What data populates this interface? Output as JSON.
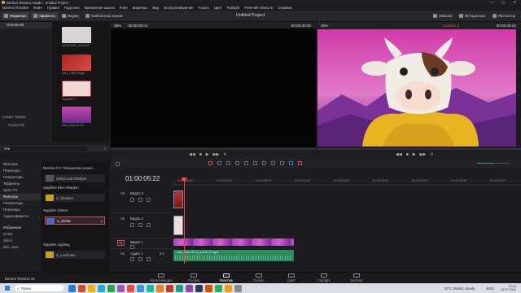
{
  "window": {
    "title": "DaVinci Resolve Studio - Untitled Project",
    "controls": [
      "—",
      "▢",
      "✕"
    ]
  },
  "menu": [
    "DaVinci Resolve",
    "Файл",
    "Правка",
    "Подгонка",
    "Временная шкала",
    "Клип",
    "Маркеры",
    "Вид",
    "Воспроизведение",
    "Fusion",
    "Цвет",
    "Fairlight",
    "Рабочий области",
    "Справка"
  ],
  "toolbar": {
    "left": [
      {
        "label": "Медиапул",
        "icon": "media-pool-icon",
        "active": true
      },
      {
        "label": "Эффекты",
        "icon": "effects-icon",
        "active": true
      },
      {
        "label": "Индекс",
        "icon": "index-icon",
        "active": false
      },
      {
        "label": "Библиотека звуков",
        "icon": "sound-library-icon",
        "active": false
      }
    ],
    "project_title": "Untitled Project",
    "right": [
      {
        "label": "Микшер",
        "icon": "mixer-icon"
      },
      {
        "label": "Метаданные",
        "icon": "metadata-icon"
      },
      {
        "label": "Инспектор",
        "icon": "inspector-icon"
      }
    ]
  },
  "viewer_bar": {
    "source_zoom": "39%",
    "source_tc": "00:00:00:01",
    "source_tc_right": "00:00:00:00",
    "program_zoom": "39%",
    "program_tc": "00:00:05:22",
    "timeline_name": "Timeline 1"
  },
  "media_pool": {
    "bin_header": "Основной",
    "smart_bins_label": "Смарт-ящики",
    "keywords_label": "Keywords",
    "clips": [
      {
        "name": "12.09.2023_15.34.57",
        "color": "#d8d4d2"
      },
      {
        "name": "icon_1280.15.jpg",
        "color": "#b8322e"
      },
      {
        "name": "Tosprite 2",
        "color": "#e8c8c2"
      },
      {
        "name": "cow_2024-07-12...",
        "color": "#9a3fa0"
      }
    ]
  },
  "effects": {
    "search_value": "sha",
    "tree": [
      {
        "label": "Фильтры",
        "sel": false
      },
      {
        "label": "Переходы",
        "sel": false
      },
      {
        "label": "Генераторы",
        "sel": false
      },
      {
        "label": "Эффекты",
        "sel": false
      },
      {
        "label": "Open FX",
        "sel": false
      },
      {
        "label": "Фильтры",
        "sel": true
      },
      {
        "label": "Генераторы",
        "sel": false
      },
      {
        "label": "Переходы",
        "sel": false
      },
      {
        "label": "Аудиоэффекты",
        "sel": false
      }
    ],
    "favorites_label": "Избранное",
    "favorites": [
      "Cross",
      "Glitch",
      "Dirt...ssor"
    ],
    "groups": [
      {
        "header": "Resolve FX: Повышение резкос...",
        "items": [
          "Soften and Sharpen"
        ]
      },
      {
        "header": "Sapphire Blur+Sharpen",
        "items": [
          "S_Sharpen"
        ]
      },
      {
        "header": "Sapphire Distort",
        "items": [
          "S_Shake"
        ]
      },
      {
        "header": "Sapphire Lighting",
        "items": [
          "S_LensFlare"
        ]
      }
    ]
  },
  "timeline": {
    "timecode": "01:00:05:22",
    "ruler": [
      "01:00:00:00",
      "01:00:04:00",
      "01:00:08:00",
      "01:00:12:00",
      "01:00:16:00",
      "01:00:20:00",
      "01:00:24:00",
      "01:00:28:00",
      "01:00:32:00"
    ],
    "tracks": [
      {
        "id": "V3",
        "name": "Видео 3"
      },
      {
        "id": "V2",
        "name": "Видео 2"
      },
      {
        "id": "V1",
        "name": "Видео 1"
      },
      {
        "id": "A1",
        "name": "Аудио 1",
        "level": "2.0"
      }
    ],
    "audio_clip_name": "cow_2024-07-13_14-31-17.mp4",
    "v2_clip": "icon",
    "v3_clip": "icon"
  },
  "pages": [
    {
      "label": "Мультимедиа",
      "active": false
    },
    {
      "label": "Сборка",
      "active": false
    },
    {
      "label": "Монтаж",
      "active": true
    },
    {
      "label": "Fusion",
      "active": false
    },
    {
      "label": "Цвет",
      "active": false
    },
    {
      "label": "Fairlight",
      "active": false
    },
    {
      "label": "Экспорт",
      "active": false
    }
  ],
  "statusbar": {
    "app_name": "DaVinci Resolve 18"
  },
  "taskbar": {
    "search_placeholder": "Поиск",
    "weather": "29°C  Mostly cloudy",
    "lang": "ENG",
    "time": "13:24",
    "date": "13.07.2024",
    "apps": [
      "#2a7ad8",
      "#d84b2a",
      "#f0b400",
      "#2aa8d8",
      "#28a745",
      "#9b59b6",
      "#e74c3c",
      "#3498db",
      "#1abc9c",
      "#e67e22",
      "#c0392b",
      "#16a085",
      "#8e44ad",
      "#2c3e50",
      "#d35400",
      "#27ae60",
      "#f39c12",
      "#7f8c8d"
    ]
  },
  "colors": {
    "accent": "#e04a4a",
    "audio": "#2e8a5a",
    "video": "#8a3f9a",
    "playhead": "#ff4040"
  }
}
